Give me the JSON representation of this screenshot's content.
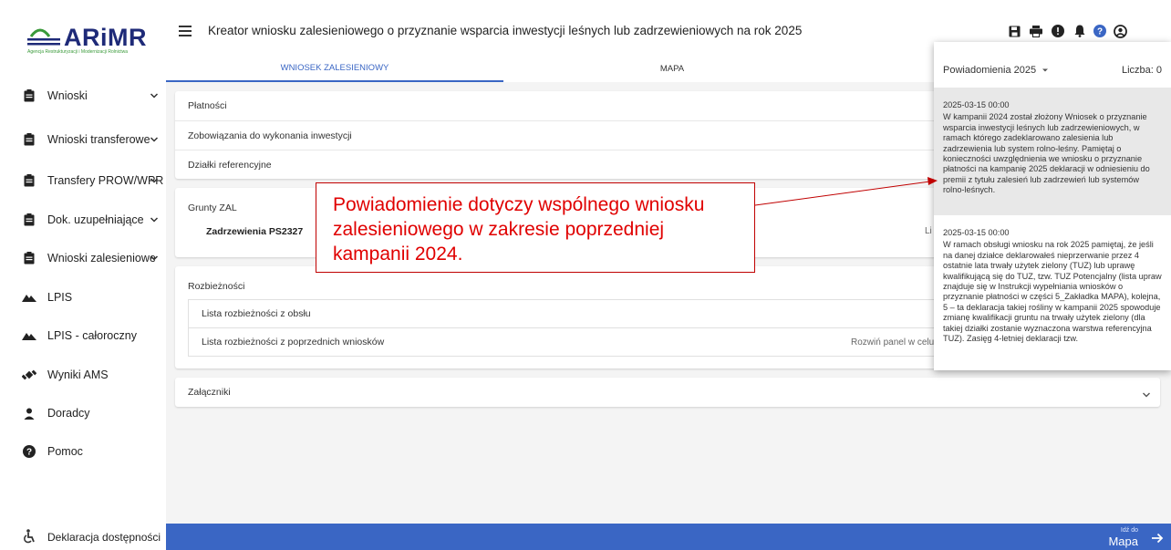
{
  "brand": {
    "name": "ARiMR",
    "subtitle": "Agencja Restrukturyzacji i Modernizacji Rolnictwa",
    "color": "#1e2a78"
  },
  "header": {
    "title": "Kreator wniosku zalesieniowego o przyznanie wsparcia inwestycji leśnych lub zadrzewieniowych na rok 2025",
    "icons": [
      "save-icon",
      "print-icon",
      "alert-icon",
      "bell-icon",
      "help-icon",
      "account-icon"
    ]
  },
  "tabs": [
    {
      "label": "WNIOSEK ZALESIENIOWY",
      "active": true
    },
    {
      "label": "MAPA",
      "active": false
    }
  ],
  "sidebar": {
    "items": [
      {
        "label": "Wnioski",
        "icon": "clipboard-icon",
        "chevron": true
      },
      {
        "label": "Wnioski transferowe",
        "icon": "clipboard-icon",
        "chevron": true
      },
      {
        "label": "Transfery PROW/WPR",
        "icon": "clipboard-icon",
        "chevron": true
      },
      {
        "label": "Dok. uzupełniające",
        "icon": "clipboard-icon",
        "chevron": true
      },
      {
        "label": "Wnioski zalesieniowe",
        "icon": "clipboard-icon",
        "chevron": true
      },
      {
        "label": "LPIS",
        "icon": "terrain-icon",
        "chevron": false
      },
      {
        "label": "LPIS - całoroczny",
        "icon": "terrain-icon",
        "chevron": false
      },
      {
        "label": "Wyniki AMS",
        "icon": "satellite-icon",
        "chevron": false
      },
      {
        "label": "Doradcy",
        "icon": "person-icon",
        "chevron": false
      },
      {
        "label": "Pomoc",
        "icon": "help-circle-icon",
        "chevron": false
      }
    ],
    "accessibility": "Deklaracja dostępności"
  },
  "main": {
    "panel1": [
      "Płatności",
      "Zobowiązania do wykonania inwestycji",
      "Działki referencyjne"
    ],
    "grunty": {
      "heading": "Grunty ZAL",
      "item": "Zadrzewienia PS2327",
      "right": "Li"
    },
    "rozbieznosci": {
      "heading": "Rozbieżności",
      "rows": [
        {
          "label": "Lista rozbieżności z obsłu",
          "hint": ""
        },
        {
          "label": "Lista rozbieżności z poprzednich wniosków",
          "hint": "Rozwiń panel w celu pob"
        }
      ]
    },
    "zalaczniki": "Załączniki"
  },
  "bottombar": {
    "goto_small": "Idź do",
    "goto_big": "Mapa",
    "color": "#3a66c4"
  },
  "notifications": {
    "title": "Powiadomienia  2025",
    "count": "Liczba: 0",
    "items": [
      {
        "date": "2025-03-15 00:00",
        "text": "W kampanii 2024 został złożony Wniosek o przyznanie wsparcia inwestycji leśnych lub zadrzewieniowych, w ramach którego zadeklarowano zalesienia lub zadrzewienia lub system rolno-leśny. Pamiętaj o konieczności uwzględnienia we wniosku o przyznanie płatności na kampanię 2025 deklaracji w odniesieniu do premii z tytułu zalesień lub zadrzewień lub systemów rolno-leśnych."
      },
      {
        "date": "2025-03-15 00:00",
        "text": "W ramach obsługi wniosku na rok 2025 pamiętaj, że jeśli na danej działce deklarowałeś nieprzerwanie przez 4 ostatnie lata trwały użytek zielony (TUZ) lub uprawę kwalifikującą się do TUZ, tzw. TUZ Potencjalny (lista upraw znajduje się w Instrukcji wypełniania wniosków o przyznanie płatności w części 5_Zakładka MAPA), kolejna, 5 – ta deklaracja takiej rośliny w kampanii 2025 spowoduje zmianę kwalifikacji gruntu na trwały użytek zielony (dla takiej działki zostanie wyznaczona warstwa referencyjna TUZ). Zasięg 4-letniej deklaracji tzw."
      }
    ]
  },
  "callout": {
    "text": "Powiadomienie dotyczy wspólnego wniosku zalesieniowego w zakresie poprzedniej kampanii 2024.",
    "color": "#e00000"
  }
}
